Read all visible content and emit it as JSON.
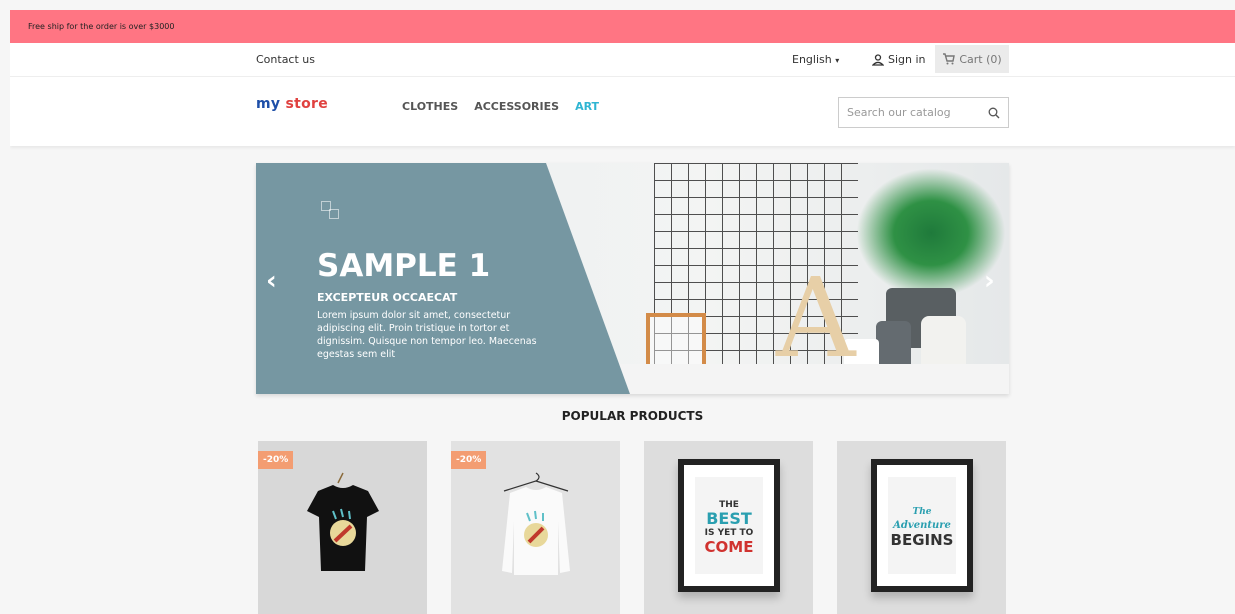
{
  "promo": {
    "text": "Free ship for the order is over $3000"
  },
  "topbar": {
    "contact": "Contact us",
    "language": "English",
    "signin": "Sign in",
    "cart": "Cart (0)"
  },
  "header": {
    "logo_part1": "my",
    "logo_part2": "store",
    "nav": [
      "CLOTHES",
      "ACCESSORIES",
      "ART"
    ],
    "search_placeholder": "Search our catalog"
  },
  "banner": {
    "title": "SAMPLE 1",
    "subtitle": "EXCEPTEUR OCCAECAT",
    "text": "Lorem ipsum dolor sit amet, consectetur adipiscing elit. Proin tristique in tortor et dignissim. Quisque non tempor leo. Maecenas egestas sem elit"
  },
  "popular": {
    "title": "POPULAR PRODUCTS",
    "products": [
      {
        "badge": "-20%"
      },
      {
        "badge": "-20%"
      },
      {
        "poster_lines": [
          "THE",
          "BEST",
          "IS YET TO",
          "COME"
        ]
      },
      {
        "poster_lines": [
          "The",
          "Adventure",
          "BEGINS"
        ]
      }
    ]
  },
  "colors": {
    "accent": "#2fb5d2",
    "promo": "#ff7583",
    "badge": "#f39d72",
    "overlay": "#7697a2"
  },
  "icons": {
    "person": "person-icon",
    "cart": "cart-icon",
    "search": "search-icon",
    "caret": "caret-down-icon",
    "prev": "chevron-left-icon",
    "next": "chevron-right-icon"
  }
}
